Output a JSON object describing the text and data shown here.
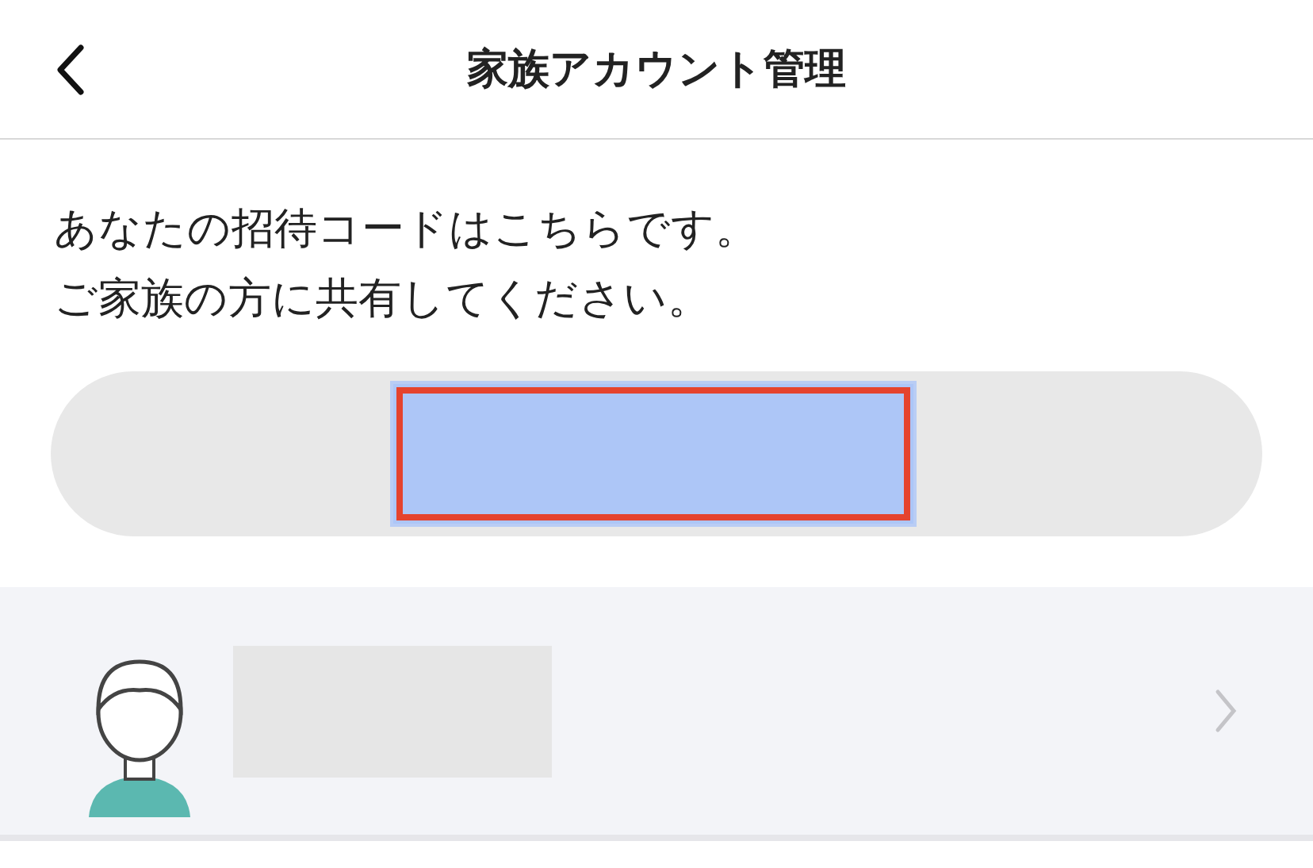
{
  "header": {
    "title": "家族アカウント管理"
  },
  "message": [
    "あなたの招待コードはこちらです。",
    "ご家族の方に共有してください。"
  ]
}
